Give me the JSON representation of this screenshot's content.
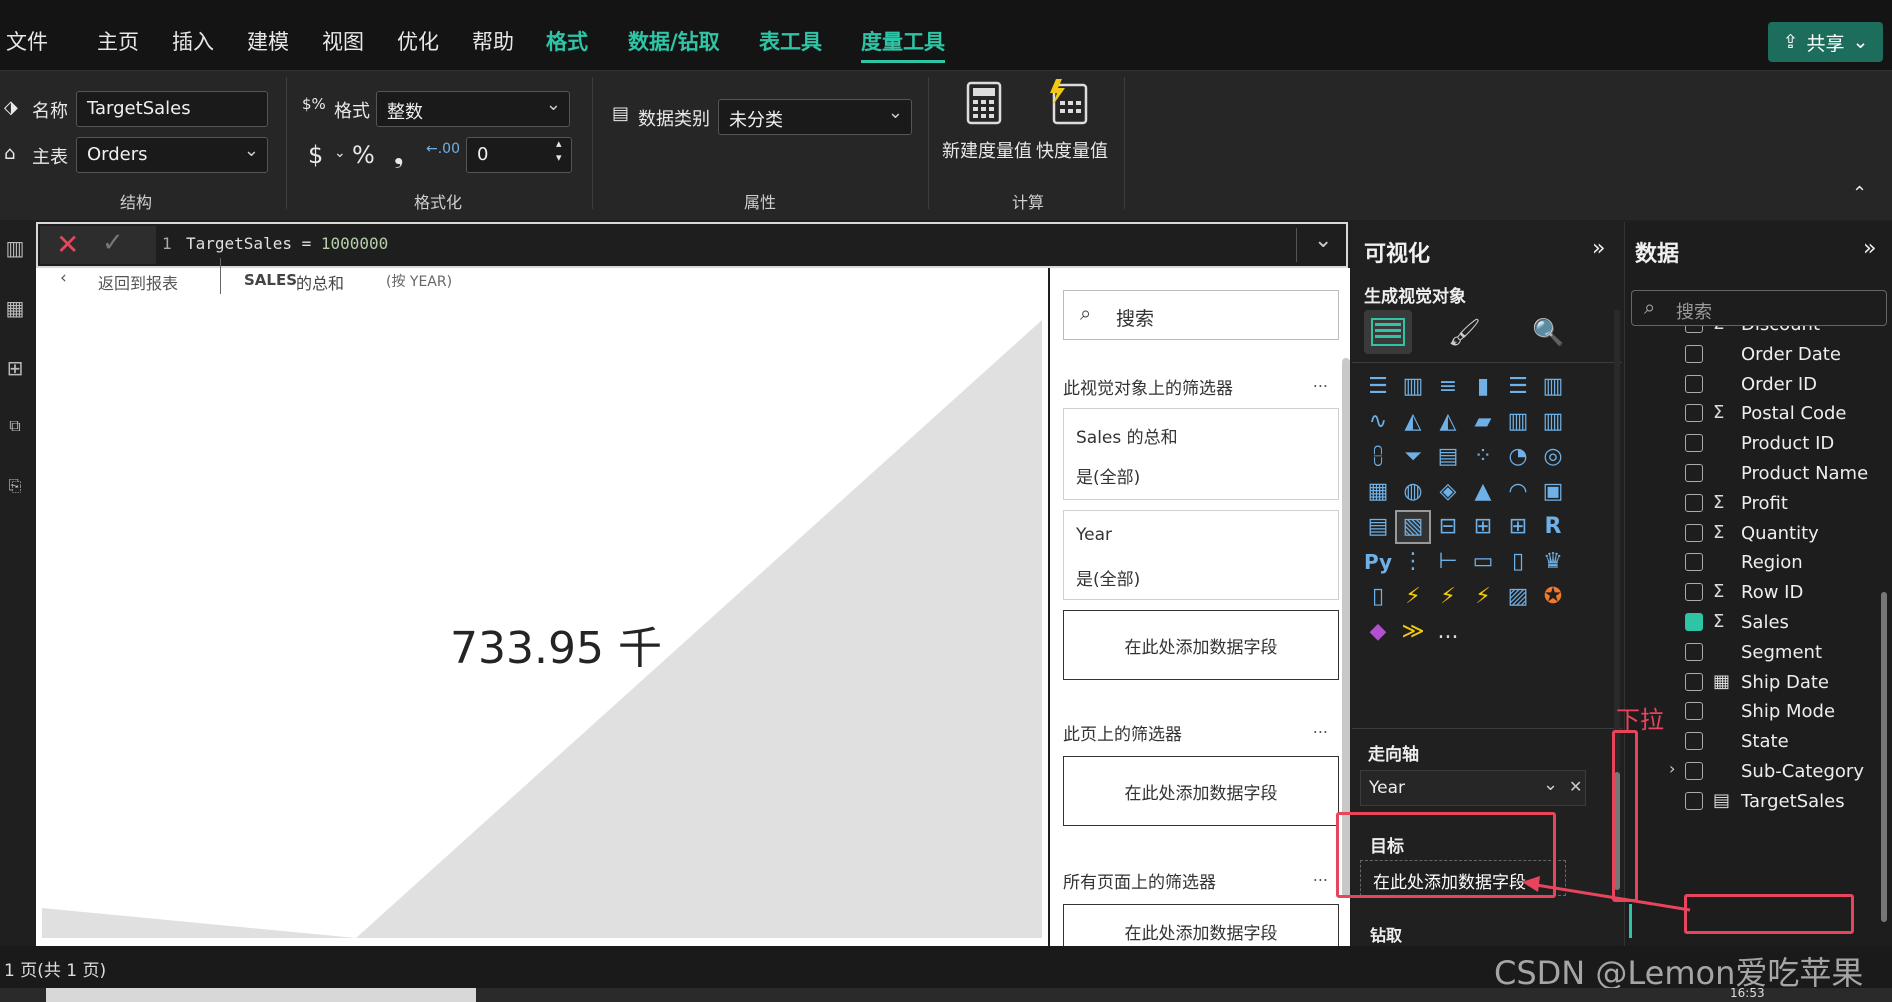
{
  "menubar": {
    "items": [
      "文件",
      "主页",
      "插入",
      "建模",
      "视图",
      "优化",
      "帮助"
    ],
    "context_items": [
      "格式",
      "数据/钻取",
      "表工具",
      "度量工具"
    ],
    "active": "度量工具",
    "share_label": "共享"
  },
  "ribbon": {
    "structure": {
      "name_label": "名称",
      "name_value": "TargetSales",
      "home_label": "主表",
      "home_value": "Orders",
      "group_label": "结构"
    },
    "formatting": {
      "format_label": "格式",
      "format_value": "整数",
      "currency_symbol": "$",
      "percent_symbol": "%",
      "comma_symbol": "❟",
      "decimal_value": "0",
      "group_label": "格式化"
    },
    "properties": {
      "category_label": "数据类别",
      "category_value": "未分类",
      "group_label": "属性"
    },
    "calculations": {
      "new_measure_label": "新建度量值",
      "quick_measure_label": "快度量值",
      "group_label": "计算"
    }
  },
  "formula": {
    "line_number": "1",
    "measure_name": "TargetSales",
    "operator": " = ",
    "value": "1000000"
  },
  "canvas": {
    "back_label": "返回到报表",
    "visual_title_bold": "SALES",
    "visual_title_rest": " 的总和",
    "visual_title_by": "(按 YEAR)",
    "kpi_value": "733.95 千"
  },
  "filters": {
    "search_placeholder": "搜索",
    "visual_filters_title": "此视觉对象上的筛选器",
    "card1_title": "Sales 的总和",
    "card1_value": "是(全部)",
    "card2_title": "Year",
    "card2_value": "是(全部)",
    "add_field": "在此处添加数据字段",
    "page_filters_title": "此页上的筛选器",
    "all_pages_title": "所有页面上的筛选器",
    "more": "..."
  },
  "visualizations": {
    "title": "可视化",
    "build_label": "生成视觉对象",
    "more_label": "...",
    "trend_axis_label": "走向轴",
    "trend_axis_value": "Year",
    "target_label": "目标",
    "target_placeholder": "在此处添加数据字段",
    "drill_label": "钻取",
    "r_label": "R",
    "py_label": "Py"
  },
  "data": {
    "title": "数据",
    "search_placeholder": "搜索",
    "fields": [
      {
        "name": "Discount",
        "sigma": true,
        "checked": false
      },
      {
        "name": "Order Date",
        "sigma": false,
        "checked": false
      },
      {
        "name": "Order ID",
        "sigma": false,
        "checked": false
      },
      {
        "name": "Postal Code",
        "sigma": true,
        "checked": false
      },
      {
        "name": "Product ID",
        "sigma": false,
        "checked": false
      },
      {
        "name": "Product Name",
        "sigma": false,
        "checked": false
      },
      {
        "name": "Profit",
        "sigma": true,
        "checked": false
      },
      {
        "name": "Quantity",
        "sigma": true,
        "checked": false
      },
      {
        "name": "Region",
        "sigma": false,
        "checked": false
      },
      {
        "name": "Row ID",
        "sigma": true,
        "checked": false
      },
      {
        "name": "Sales",
        "sigma": true,
        "checked": true
      },
      {
        "name": "Segment",
        "sigma": false,
        "checked": false
      },
      {
        "name": "Ship Date",
        "sigma": false,
        "checked": false
      },
      {
        "name": "Ship Mode",
        "sigma": false,
        "checked": false
      },
      {
        "name": "State",
        "sigma": false,
        "checked": false
      },
      {
        "name": "Sub-Category",
        "sigma": false,
        "checked": false
      },
      {
        "name": "TargetSales",
        "sigma": false,
        "checked": false
      }
    ]
  },
  "annotation": {
    "pull_down": "下拉"
  },
  "status": {
    "page_label": "1 页(共 1 页)",
    "watermark": "CSDN @Lemon爱吃苹果",
    "clock": "16:53"
  },
  "colors": {
    "accent": "#2ec4a5",
    "annotation_red": "#e8455d",
    "share_bg": "#1c6d5c"
  }
}
